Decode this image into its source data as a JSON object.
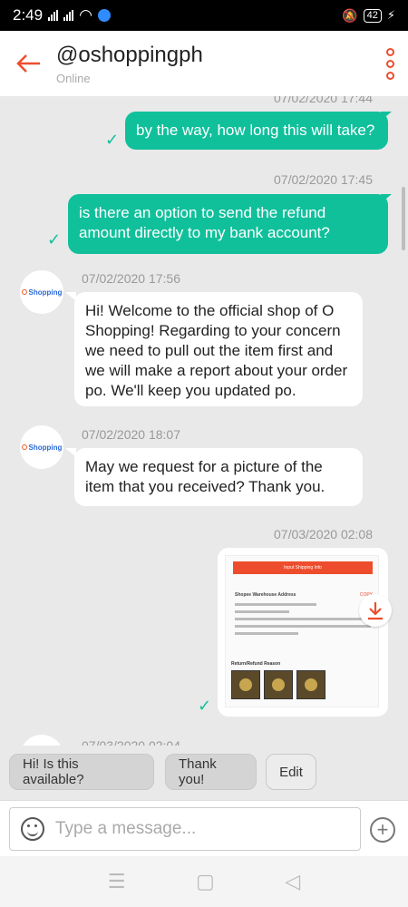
{
  "status_bar": {
    "time": "2:49",
    "battery": "42"
  },
  "header": {
    "title": "@oshoppingph",
    "subtitle": "Online"
  },
  "messages": [
    {
      "timestamp": "07/02/2020 17:44",
      "text": "by the way, how long this will take?"
    },
    {
      "timestamp": "07/02/2020 17:45",
      "text": "is there an option to send the refund amount directly to my bank account?"
    },
    {
      "timestamp": "07/02/2020 17:56",
      "text": "Hi! Welcome to the official shop of O Shopping! Regarding to your concern we need to pull out the item first and we will make a report about your order po. We'll keep you updated po."
    },
    {
      "timestamp": "07/02/2020 18:07",
      "text": "May we request for a picture of the item that you received? Thank you."
    },
    {
      "timestamp": "07/03/2020 02:08"
    },
    {
      "timestamp": "07/03/2020 02:04"
    }
  ],
  "avatar_label": "Shopping",
  "image_doc": {
    "button": "Input Shipping Info",
    "address_title": "Shopee Warehouse Address",
    "copy": "COPY",
    "reason_title": "Return/Refund Reason"
  },
  "quick_replies": [
    "Hi! Is this available?",
    "Thank you!",
    "Edit"
  ],
  "input": {
    "placeholder": "Type a message..."
  },
  "colors": {
    "accent": "#ee4d2d",
    "bubble_out": "#10c09b"
  }
}
